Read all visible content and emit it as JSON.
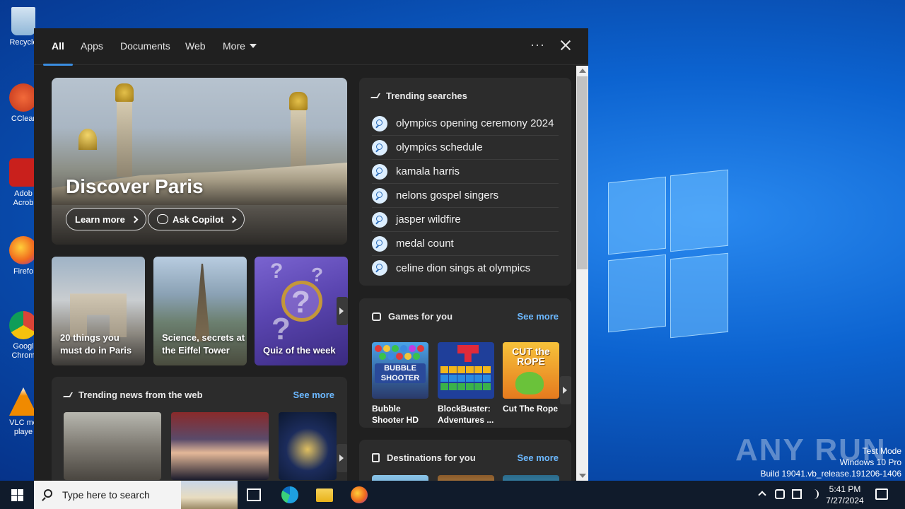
{
  "desktop": {
    "icons": [
      {
        "label": "Recycle",
        "color": "#8fb7d8"
      },
      {
        "label": "CClear",
        "color": "#d94c2c"
      },
      {
        "label": "Adob Acrob",
        "color": "#c9201c"
      },
      {
        "label": "Firefo",
        "color": "#f06a1e"
      },
      {
        "label": "Googl Chrom",
        "color": "#2f9a4a"
      },
      {
        "label": "VLC me playe",
        "color": "#f08a00"
      }
    ],
    "watermark": "ANY RUN",
    "test_mode": [
      "Test Mode",
      "Windows 10 Pro",
      "Build 19041.vb_release.191206-1406"
    ]
  },
  "panel": {
    "tabs": [
      "All",
      "Apps",
      "Documents",
      "Web",
      "More"
    ],
    "more_menu_icon": "ellipsis-icon",
    "hero": {
      "title": "Discover Paris",
      "learn_more": "Learn more",
      "ask_copilot": "Ask Copilot"
    },
    "tiles": [
      {
        "caption_line1": "20 things you",
        "caption_line2": "must do in Paris"
      },
      {
        "caption_line1": "Science, secrets at",
        "caption_line2": "the Eiffel Tower"
      },
      {
        "caption_line1": "Quiz of the week",
        "caption_line2": ""
      }
    ],
    "trending": {
      "title": "Trending searches",
      "items": [
        "olympics opening ceremony 2024",
        "olympics schedule",
        "kamala harris",
        "nelons gospel singers",
        "jasper wildfire",
        "medal count",
        "celine dion sings at olympics"
      ]
    },
    "games": {
      "title": "Games for you",
      "see_more": "See more",
      "items": [
        {
          "name_line1": "Bubble",
          "name_line2": "Shooter HD",
          "thumb_text": "BUBBLE SHOOTER"
        },
        {
          "name_line1": "BlockBuster:",
          "name_line2": "Adventures ...",
          "thumb_text": ""
        },
        {
          "name_line1": "Cut The Rope",
          "name_line2": "",
          "thumb_text": "CUT the ROPE"
        }
      ]
    },
    "news": {
      "title": "Trending news from the web",
      "see_more": "See more"
    },
    "destinations": {
      "title": "Destinations for you",
      "see_more": "See more"
    }
  },
  "taskbar": {
    "search_placeholder": "Type here to search",
    "time": "5:41 PM",
    "date": "7/27/2024"
  }
}
